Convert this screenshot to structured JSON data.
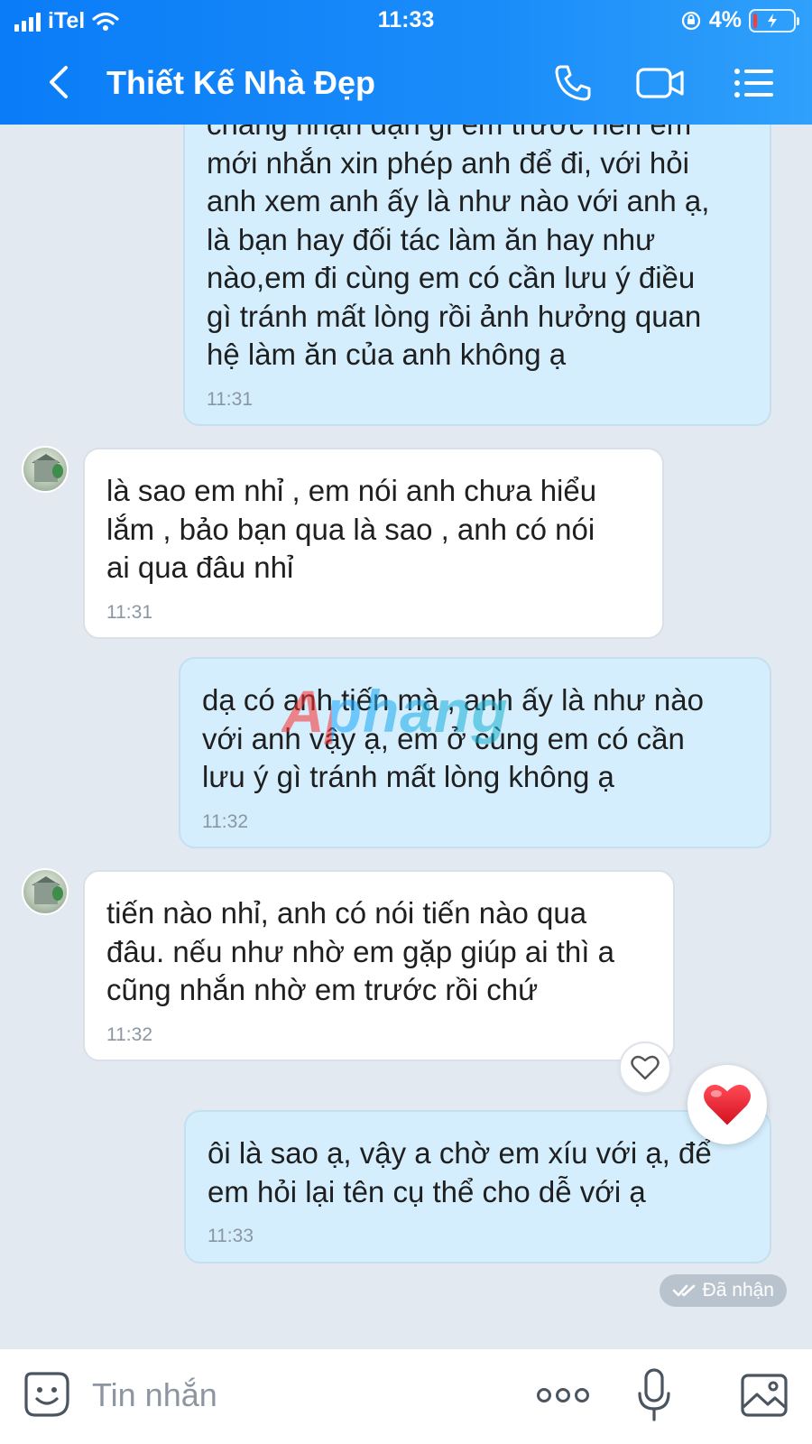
{
  "status_bar": {
    "carrier": "iTel",
    "time": "11:33",
    "battery": "4%"
  },
  "header": {
    "title": "Thiết Kế Nhà Đẹp"
  },
  "messages": [
    {
      "direction": "sent",
      "text": "chẳng nhận dạn gì em trước nên em\nmới nhắn xin phép anh để đi, với hỏi\nanh xem anh ấy là như nào với anh ạ,\nlà bạn hay đối tác làm ăn hay như\nnào,em đi cùng em có cần lưu ý điều\ngì tránh mất lòng rồi ảnh hưởng quan\nhệ làm ăn của anh không ạ",
      "time": "11:31"
    },
    {
      "direction": "received",
      "text": "là sao em nhỉ , em nói anh chưa hiểu\nlắm , bảo bạn qua là sao , anh có nói\nai qua đâu nhỉ",
      "time": "11:31"
    },
    {
      "direction": "sent",
      "text": "dạ có anh tiến mà , anh ấy là như nào\nvới anh vậy ạ, em ở cùng em có cần\nlưu ý gì tránh mất lòng không ạ",
      "time": "11:32"
    },
    {
      "direction": "received",
      "text": "tiến nào nhỉ, anh có nói tiến nào qua\nđâu. nếu như nhờ em gặp giúp ai thì a\ncũng nhắn nhờ em trước rồi chứ",
      "time": "11:32"
    },
    {
      "direction": "sent",
      "text": "ôi là sao ạ, vậy a chờ em xíu với ạ, để\nem hỏi lại tên cụ thể cho dễ với ạ",
      "time": "11:33"
    }
  ],
  "watermark": "Aphang",
  "receipt_status": "Đã nhận",
  "input": {
    "placeholder": "Tin nhắn"
  },
  "colors": {
    "header_blue": "#0a7cf8",
    "sent_bubble": "#d4eefe",
    "received_bubble": "#ffffff",
    "chat_background": "#e2e9f1",
    "heart_red": "#e8202e"
  }
}
